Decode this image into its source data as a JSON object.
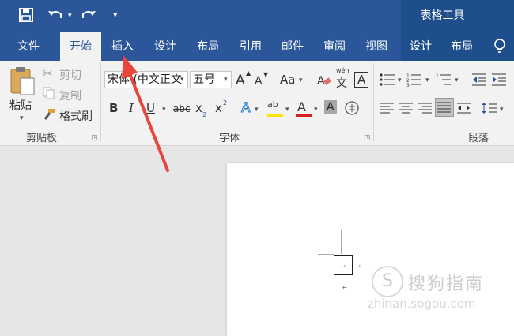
{
  "context_tab_group": "表格工具",
  "quick_access": {
    "customize_caret": "▾"
  },
  "tabs": [
    "文件",
    "开始",
    "插入",
    "设计",
    "布局",
    "引用",
    "邮件",
    "审阅",
    "视图",
    "设计",
    "布局"
  ],
  "clipboard": {
    "paste": "粘贴",
    "cut": "剪切",
    "copy": "复制",
    "format_painter": "格式刷",
    "group_label": "剪贴板"
  },
  "font": {
    "font_name": "宋体 (中文正文",
    "font_size": "五号",
    "grow": "A",
    "shrink": "A",
    "case": "Aa",
    "phonetic_top": "wén",
    "phonetic_char": "文",
    "border_char": "A",
    "bold": "B",
    "italic": "I",
    "underline": "U",
    "strike": "abc",
    "subscript": "x",
    "sub_mark": "2",
    "superscript": "x",
    "sup_mark": "2",
    "effects": "A",
    "highlight": "ab",
    "color": "A",
    "shading": "A",
    "enclose": "字",
    "group_label": "字体"
  },
  "paragraph": {
    "group_label": "段落"
  },
  "document": {
    "paragraph_mark": "↵"
  },
  "watermark": {
    "logo": "S",
    "text": "搜狗指南",
    "url": "zhinan.sogou.com"
  },
  "colors": {
    "ribbon_blue": "#2b579a",
    "context_blue": "#1f4e8c",
    "highlight_yellow": "#ffe600",
    "font_red": "#e02020",
    "arrow_red": "#e8463c"
  }
}
